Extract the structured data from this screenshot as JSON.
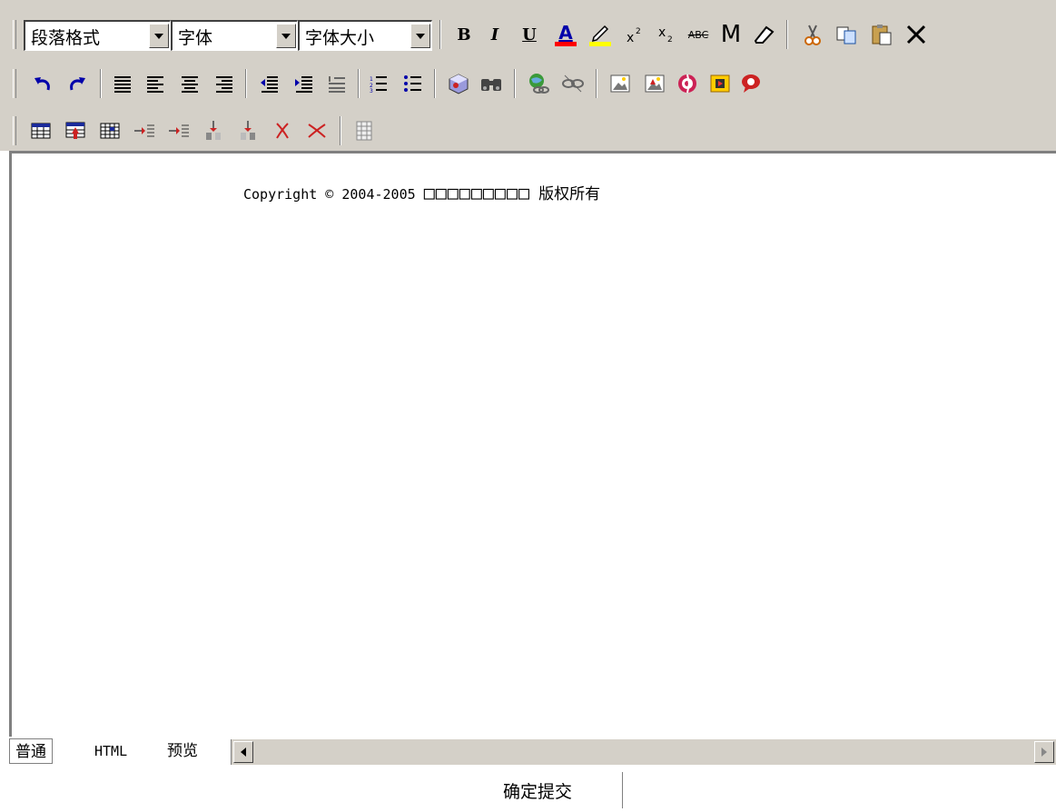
{
  "toolbar": {
    "paragraph_format": "段落格式",
    "font": "字体",
    "font_size": "字体大小",
    "bold": "B",
    "italic": "I",
    "underline": "U",
    "font_color_letter": "A",
    "strikethrough": "ABC",
    "special_char": "M"
  },
  "content": {
    "copyright_prefix": "Copyright © 2004-2005",
    "copyright_boxes": "□□□□□□□□□",
    "copyright_suffix": "版权所有"
  },
  "tabs": {
    "normal": "普通",
    "html": "HTML",
    "preview": "预览"
  },
  "submit_label": "确定提交",
  "colors": {
    "toolbar_bg": "#d4d0c8",
    "font_color_bar": "#ff0000",
    "highlight_bar": "#ffff00",
    "undo_redo": "#0000aa"
  }
}
